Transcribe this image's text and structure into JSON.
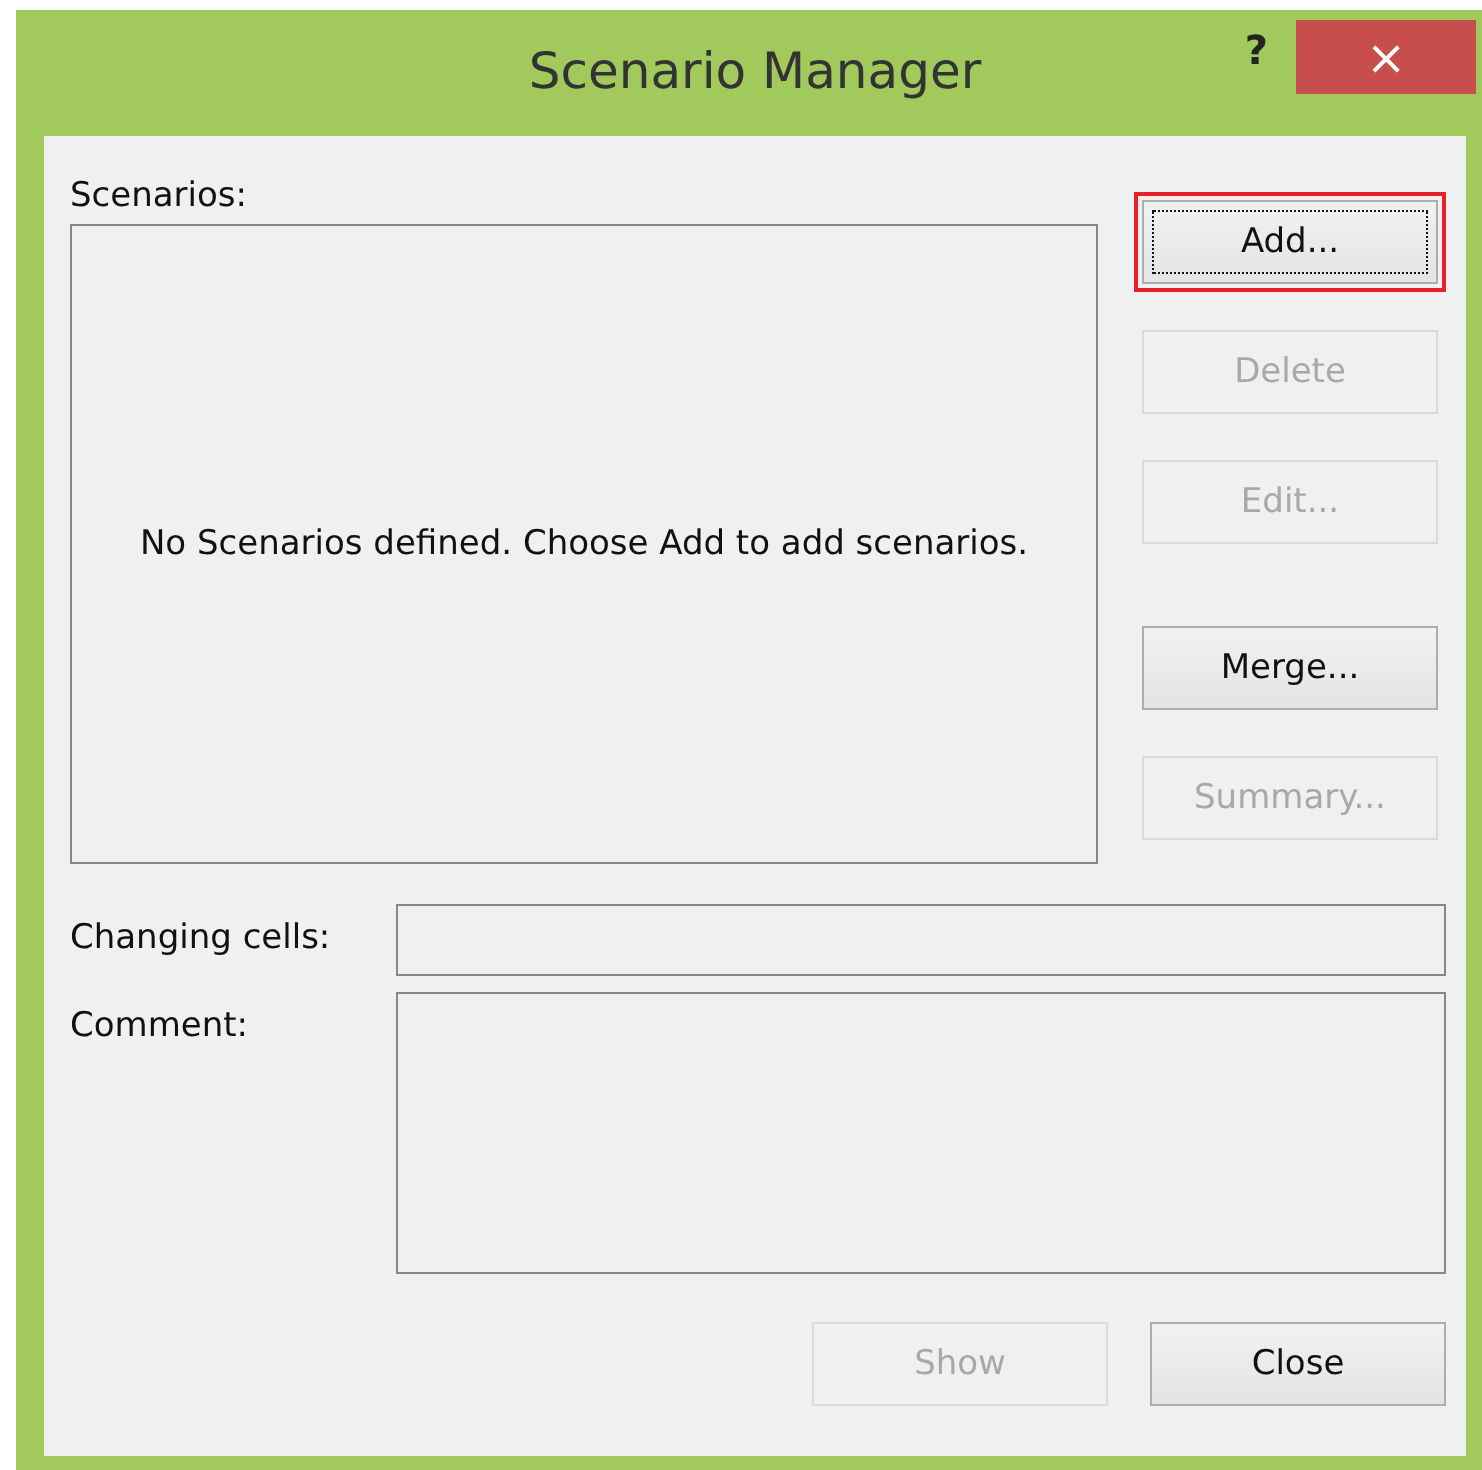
{
  "window": {
    "title": "Scenario Manager",
    "help": "?",
    "close": "×"
  },
  "scenarios": {
    "label": "Scenarios:",
    "empty_message": "No Scenarios defined. Choose Add to add scenarios."
  },
  "side_buttons": [
    {
      "label": "Add...",
      "disabled": false,
      "focused": true,
      "highlighted": true
    },
    {
      "label": "Delete",
      "disabled": true,
      "focused": false,
      "highlighted": false
    },
    {
      "label": "Edit...",
      "disabled": true,
      "focused": false,
      "highlighted": false
    },
    {
      "label": "Merge...",
      "disabled": false,
      "focused": false,
      "highlighted": false
    },
    {
      "label": "Summary...",
      "disabled": true,
      "focused": false,
      "highlighted": false
    }
  ],
  "changing_cells": {
    "label": "Changing cells:"
  },
  "comment": {
    "label": "Comment:"
  },
  "bottom_buttons": [
    {
      "label": "Show",
      "disabled": true
    },
    {
      "label": "Close",
      "disabled": false
    }
  ]
}
